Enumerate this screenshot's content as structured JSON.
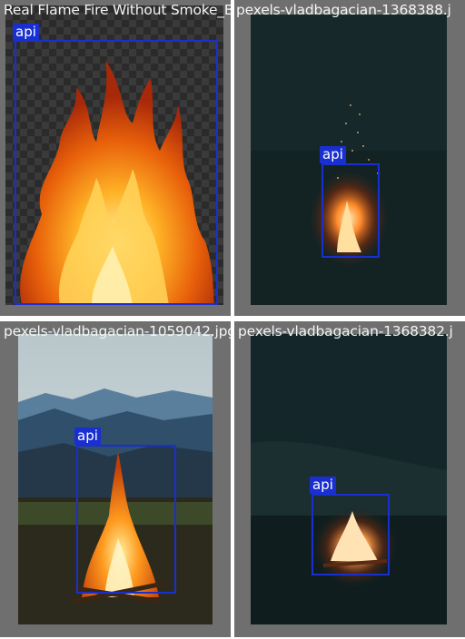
{
  "tiles": [
    {
      "filename": "Real Flame Fire Without Smoke_Black-ba",
      "detection": {
        "label": "api"
      }
    },
    {
      "filename": "pexels-vladbagacian-1368388.j",
      "detection": {
        "label": "api"
      }
    },
    {
      "filename": "pexels-vladbagacian-1059042.jpg",
      "detection": {
        "label": "api"
      }
    },
    {
      "filename": "pexels-vladbagacian-1368382.j",
      "detection": {
        "label": "api"
      }
    }
  ],
  "colors": {
    "box": "#1a2fd0",
    "tile_bg": "#6f6f6f"
  }
}
